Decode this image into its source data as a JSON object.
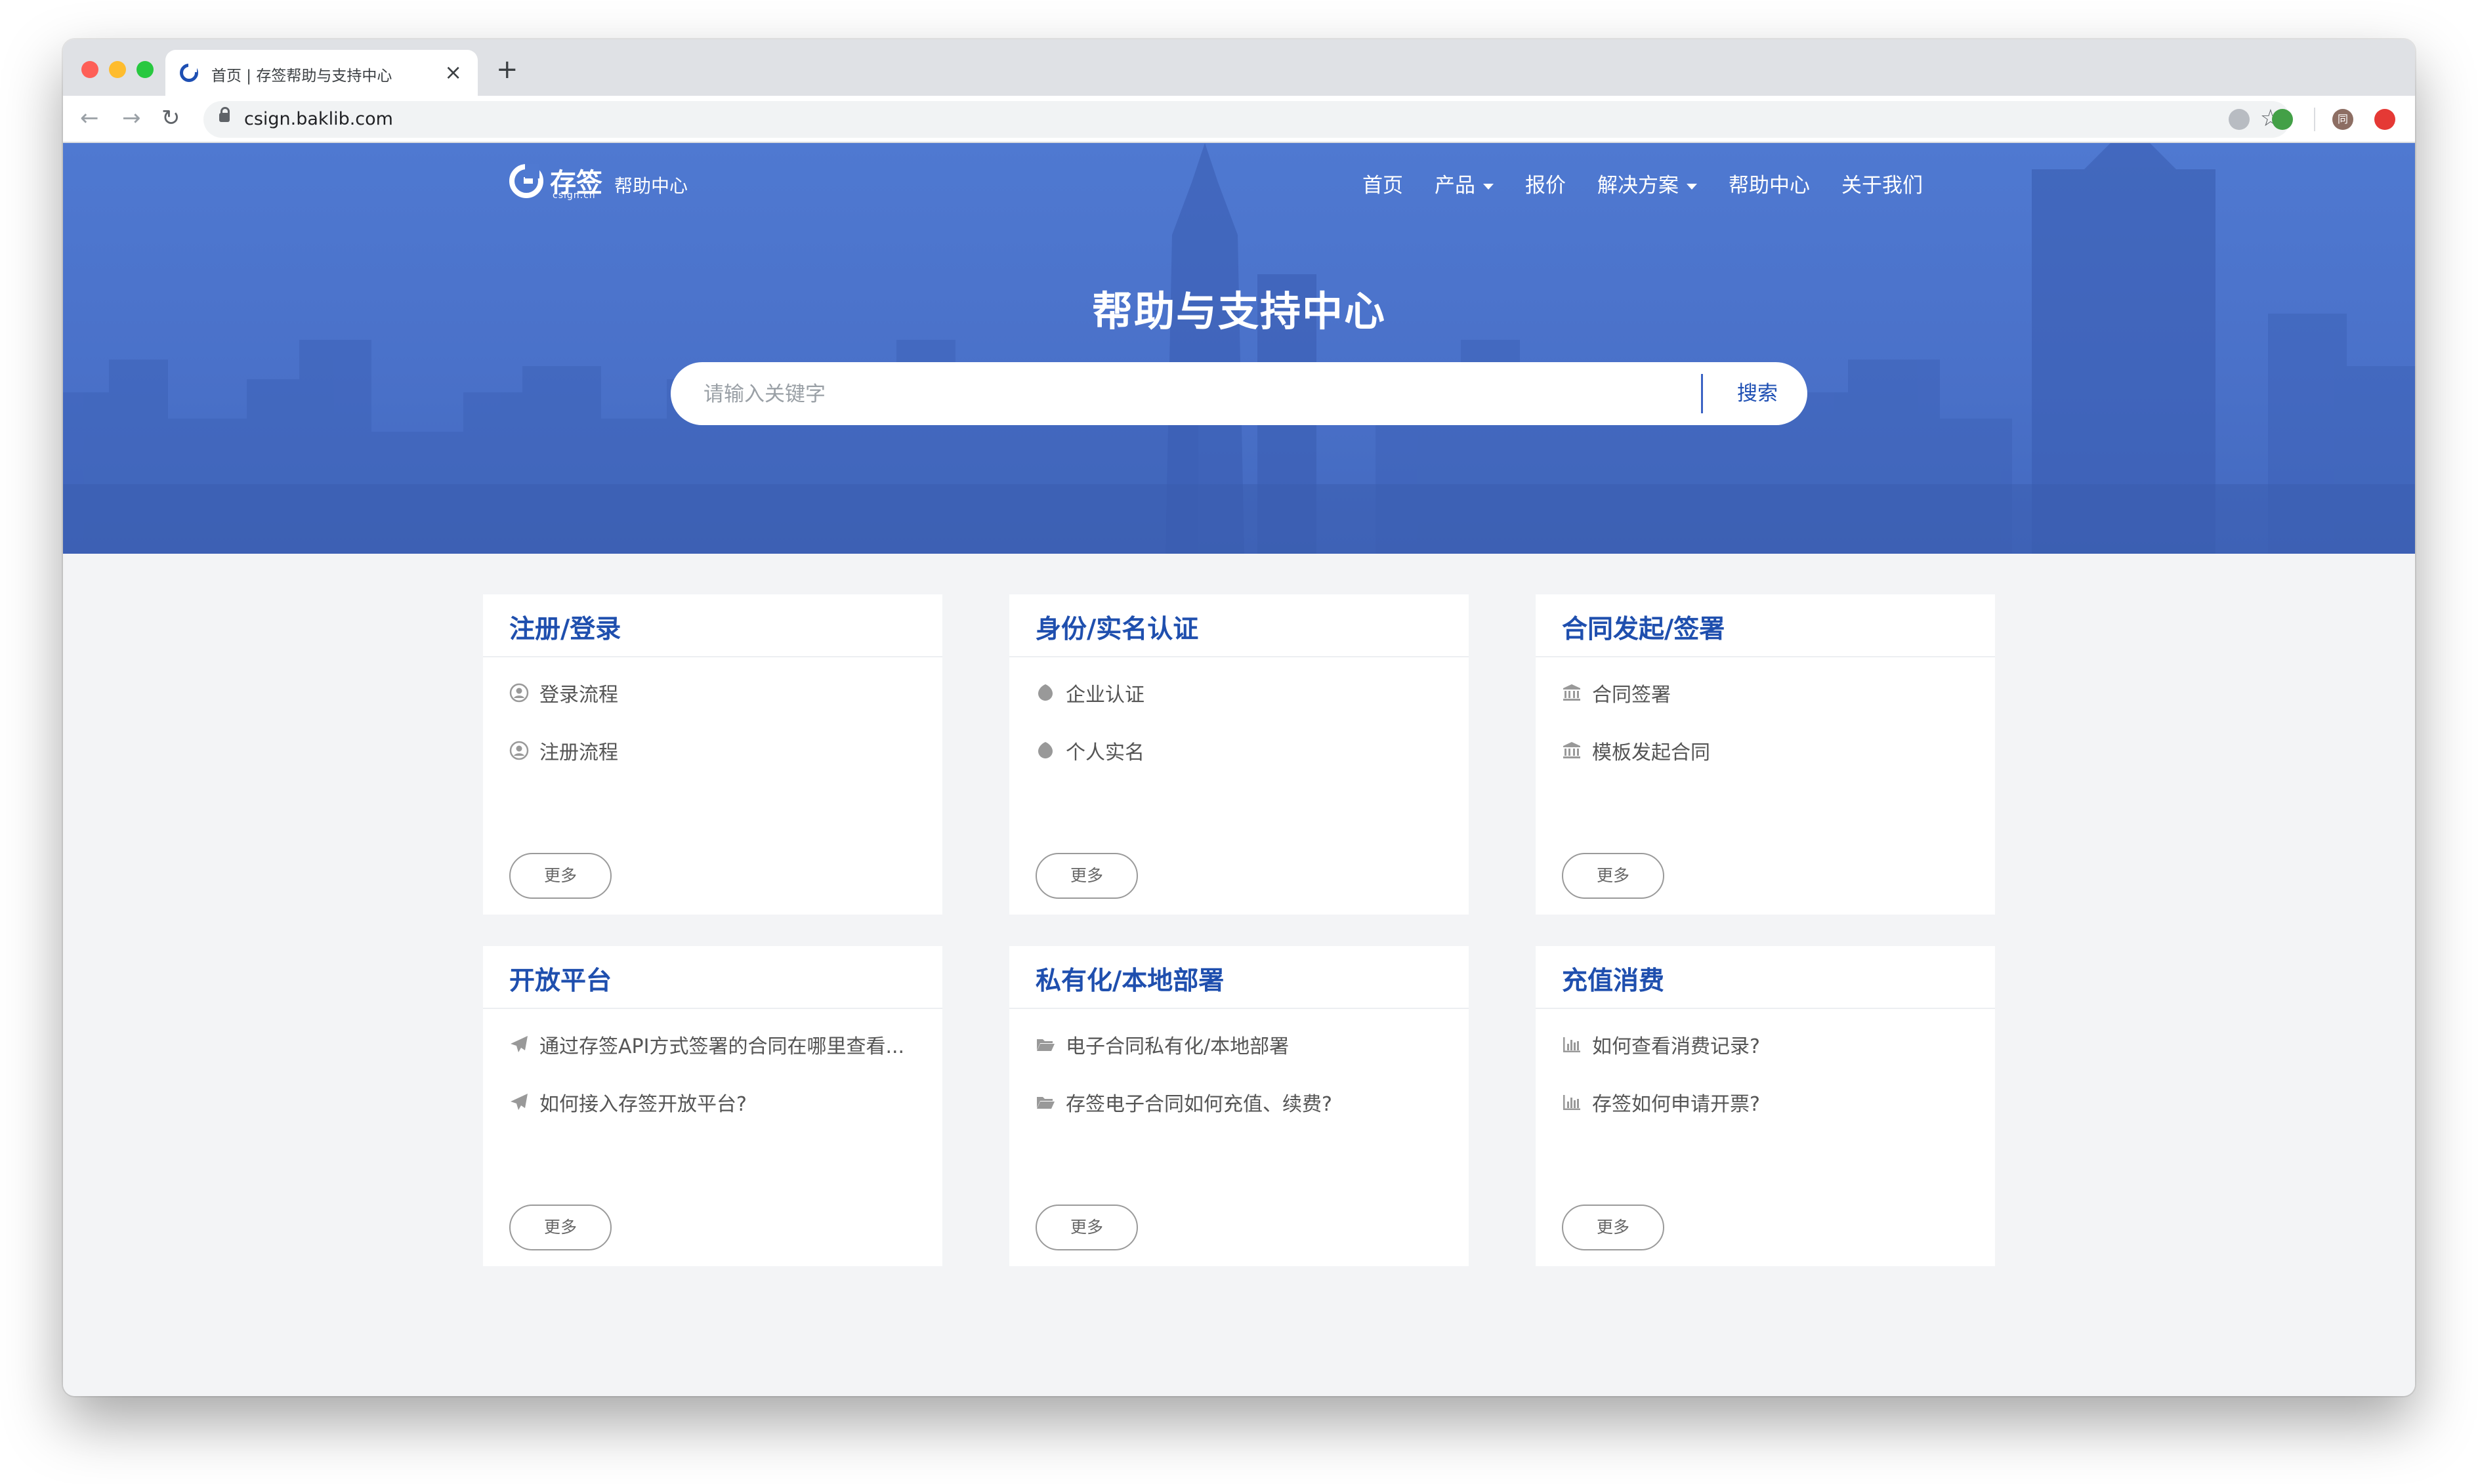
{
  "browser": {
    "tab_title": "首页 | 存签帮助与支持中心",
    "url": "csign.baklib.com",
    "profile_initial": "同"
  },
  "header": {
    "logo_name": "存签",
    "logo_domain": "csign.cn",
    "logo_help": "帮助中心",
    "nav": [
      "首页",
      "产品",
      "报价",
      "解决方案",
      "帮助中心",
      "关于我们"
    ]
  },
  "hero": {
    "title": "帮助与支持中心",
    "search_placeholder": "请输入关键字",
    "search_button": "搜索"
  },
  "cards": [
    {
      "title": "注册/登录",
      "icon": "user-circle-icon",
      "items": [
        "登录流程",
        "注册流程"
      ],
      "more": "更多"
    },
    {
      "title": "身份/实名认证",
      "icon": "rebel-icon",
      "items": [
        "企业认证",
        "个人实名"
      ],
      "more": "更多"
    },
    {
      "title": "合同发起/签署",
      "icon": "bank-icon",
      "items": [
        "合同签署",
        "模板发起合同"
      ],
      "more": "更多"
    },
    {
      "title": "开放平台",
      "icon": "paper-plane-icon",
      "items": [
        "通过存签API方式签署的合同在哪里查看...",
        "如何接入存签开放平台?"
      ],
      "more": "更多"
    },
    {
      "title": "私有化/本地部署",
      "icon": "folder-open-icon",
      "items": [
        "电子合同私有化/本地部署",
        "存签电子合同如何充值、续费?"
      ],
      "more": "更多"
    },
    {
      "title": "充值消费",
      "icon": "bar-chart-icon",
      "items": [
        "如何查看消费记录?",
        "存签如何申请开票?"
      ],
      "more": "更多"
    }
  ],
  "colors": {
    "hero_blue": "#4f79d1",
    "title_blue": "#1f4fae",
    "page_bg": "#f3f4f6"
  }
}
